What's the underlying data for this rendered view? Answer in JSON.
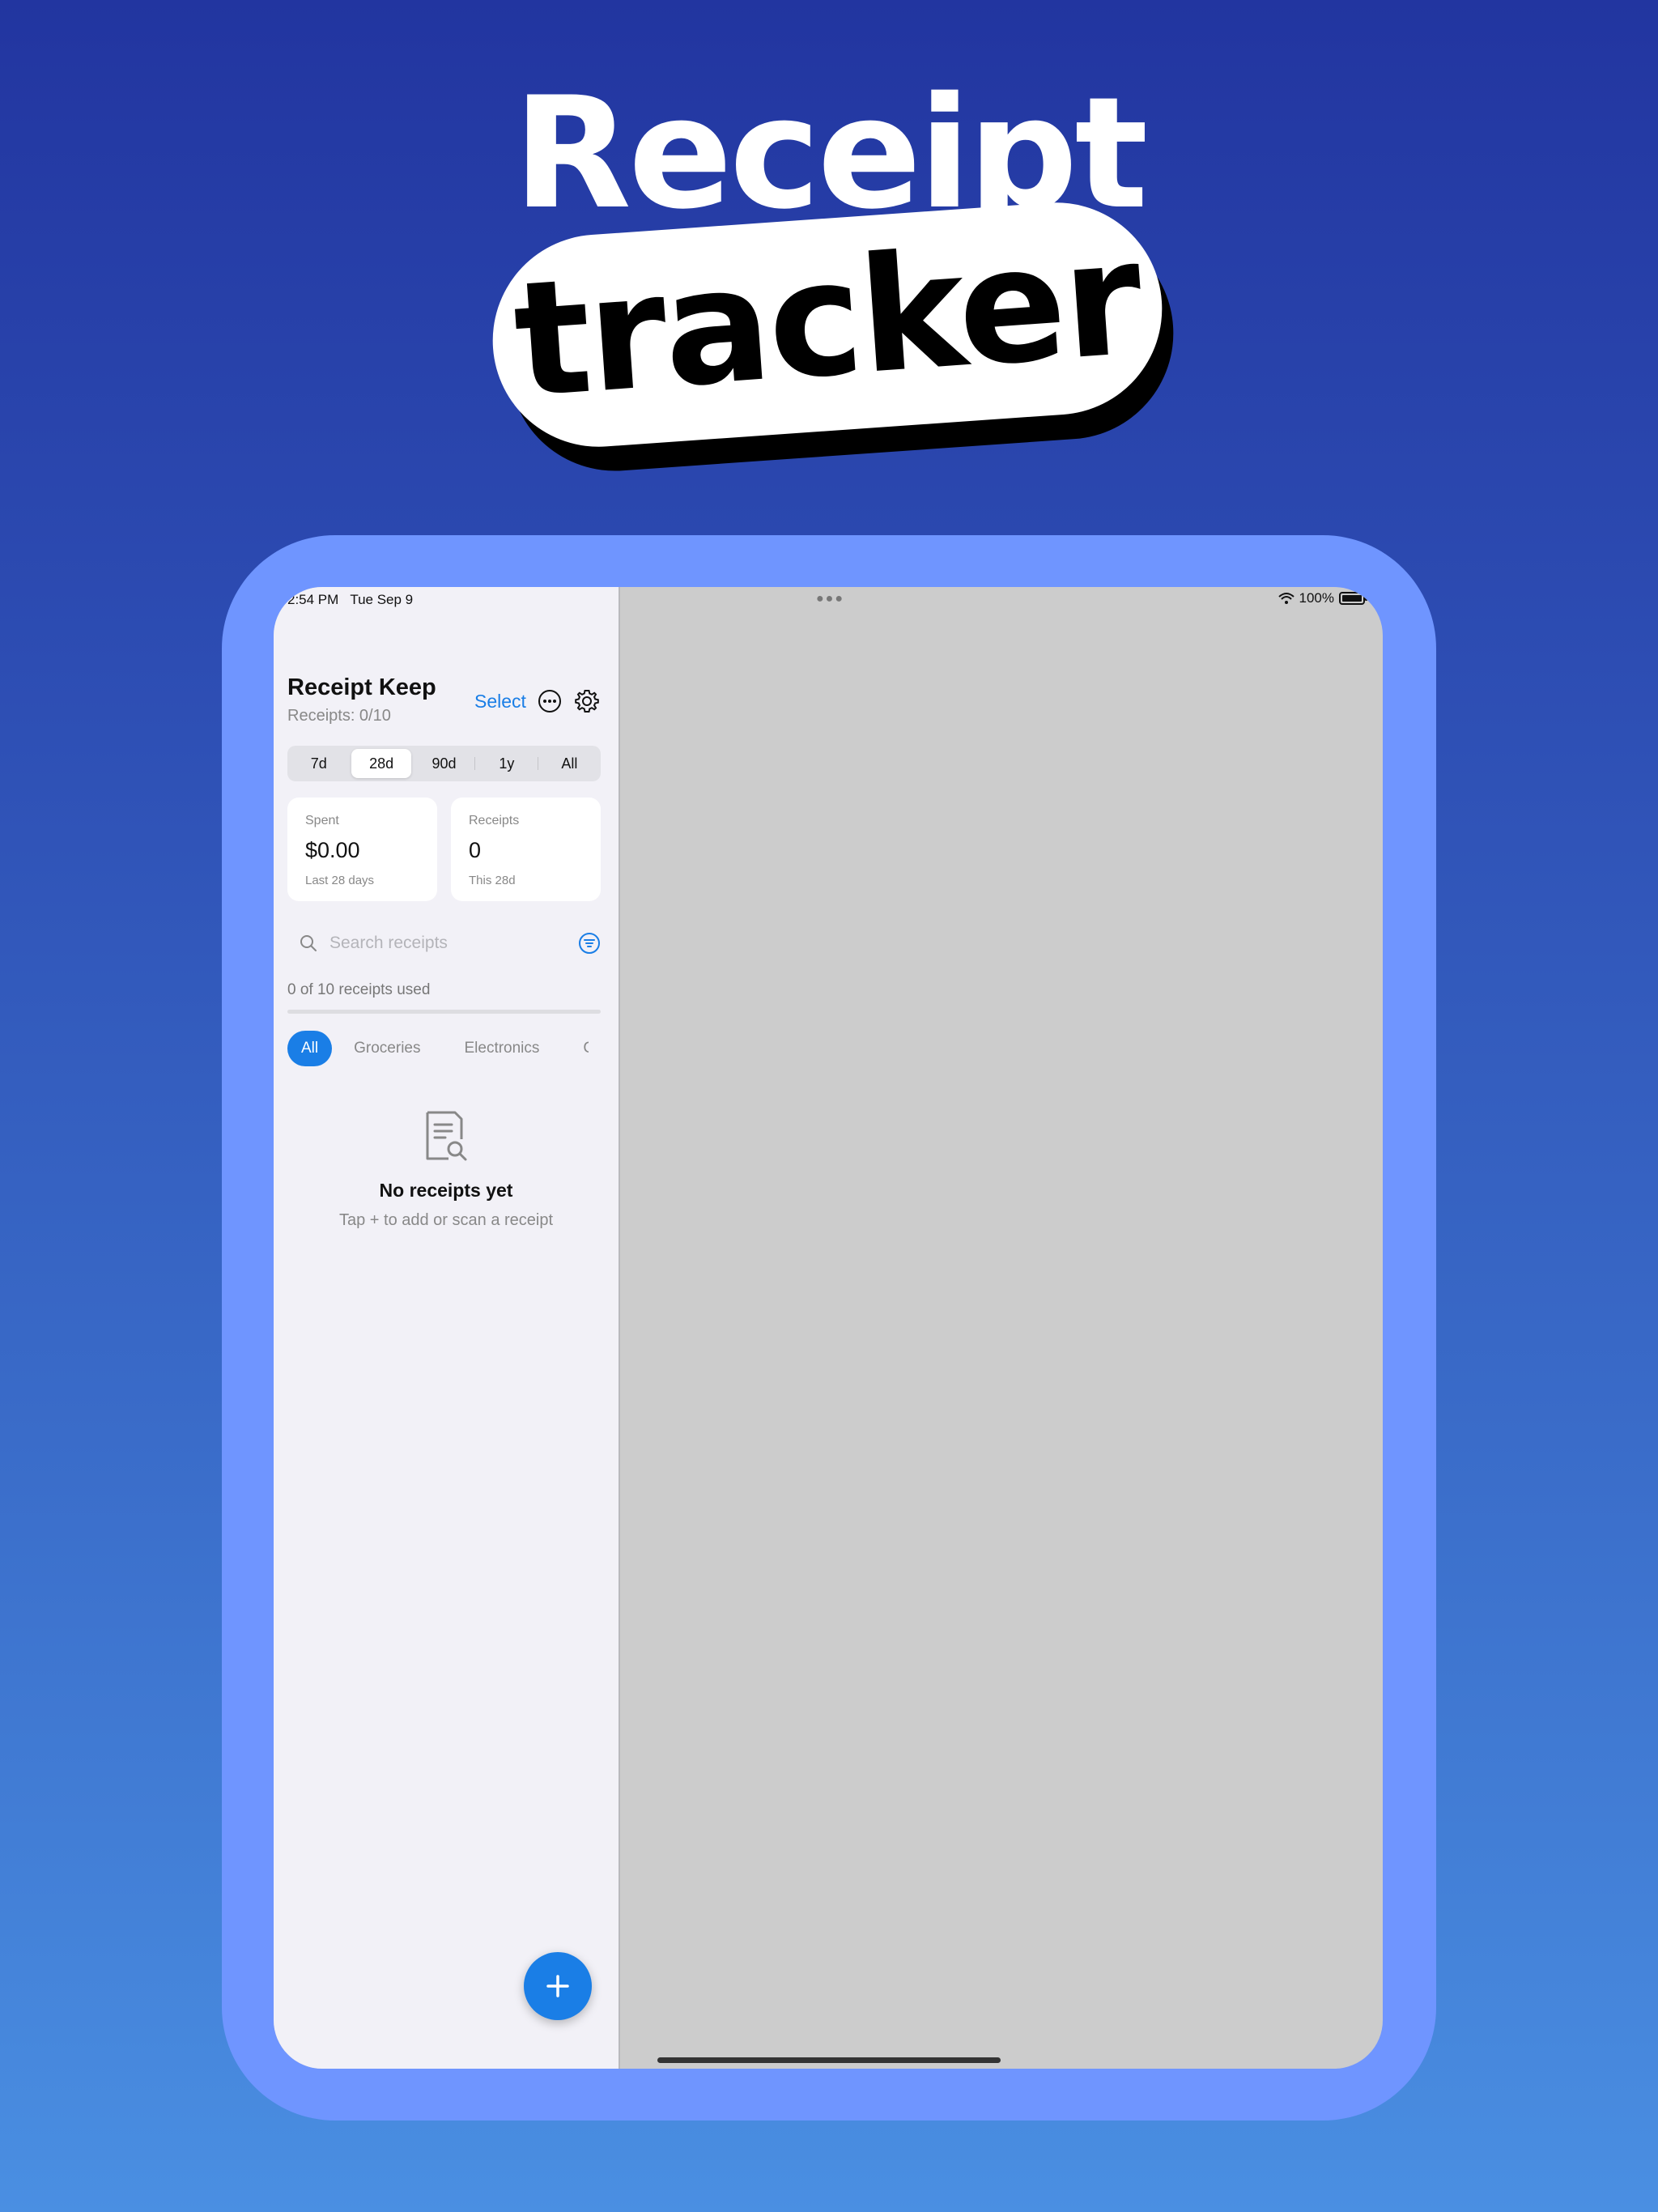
{
  "headline": {
    "line1": "Receipt",
    "line2": "tracker"
  },
  "status_bar": {
    "time": "2:54 PM",
    "date": "Tue Sep 9",
    "battery": "100%"
  },
  "app": {
    "title": "Receipt Keep",
    "subtitle": "Receipts: 0/10",
    "select_label": "Select"
  },
  "range_tabs": [
    {
      "label": "7d"
    },
    {
      "label": "28d",
      "active": true
    },
    {
      "label": "90d"
    },
    {
      "label": "1y"
    },
    {
      "label": "All"
    }
  ],
  "cards": {
    "spent": {
      "label": "Spent",
      "value": "$0.00",
      "foot": "Last 28 days"
    },
    "receipts": {
      "label": "Receipts",
      "value": "0",
      "foot": "This 28d"
    }
  },
  "search": {
    "placeholder": "Search receipts"
  },
  "usage": {
    "text": "0 of 10 receipts used",
    "used": 0,
    "limit": 10
  },
  "categories": [
    {
      "label": "All",
      "active": true
    },
    {
      "label": "Groceries"
    },
    {
      "label": "Electronics"
    },
    {
      "label": "Cl"
    }
  ],
  "empty_state": {
    "title": "No receipts yet",
    "subtitle": "Tap + to add or scan a receipt"
  },
  "icons": [
    "more-icon",
    "gear-icon",
    "search-icon",
    "filter-icon",
    "receipt-search-icon",
    "plus-icon",
    "wifi-icon",
    "battery-icon"
  ],
  "colors": {
    "accent": "#1a7ee6",
    "device_frame": "#6f95ff",
    "sidebar_bg": "#f2f1f7",
    "detail_bg": "#cccccc"
  }
}
